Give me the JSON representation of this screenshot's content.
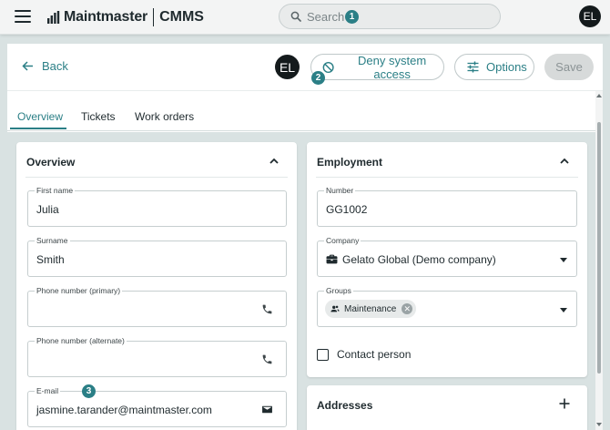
{
  "app": {
    "brand": "Maintmaster",
    "product": "CMMS",
    "search_placeholder": "Search",
    "search_badge": "1",
    "user_initials": "EL"
  },
  "toolbar": {
    "back_label": "Back",
    "user_initials": "EL",
    "deny_label": "Deny system access",
    "deny_badge": "2",
    "options_label": "Options",
    "save_label": "Save"
  },
  "tabs": [
    {
      "label": "Overview",
      "active": true
    },
    {
      "label": "Tickets",
      "active": false
    },
    {
      "label": "Work orders",
      "active": false
    }
  ],
  "overview": {
    "title": "Overview",
    "fields": [
      {
        "label": "First name",
        "value": "Julia"
      },
      {
        "label": "Surname",
        "value": "Smith"
      },
      {
        "label": "Phone number (primary)",
        "value": ""
      },
      {
        "label": "Phone number (alternate)",
        "value": ""
      },
      {
        "label": "E-mail",
        "value": "jasmine.tarander@maintmaster.com",
        "badge": "3"
      }
    ]
  },
  "employment": {
    "title": "Employment",
    "number": {
      "label": "Number",
      "value": "GG1002"
    },
    "company": {
      "label": "Company",
      "value": "Gelato Global (Demo company)"
    },
    "groups": {
      "label": "Groups",
      "chip": "Maintenance"
    },
    "contact_person_label": "Contact person"
  },
  "addresses": {
    "title": "Addresses"
  },
  "colors": {
    "accent": "#2b7f86",
    "background": "#d9e2e2",
    "avatar": "#141a1c"
  }
}
